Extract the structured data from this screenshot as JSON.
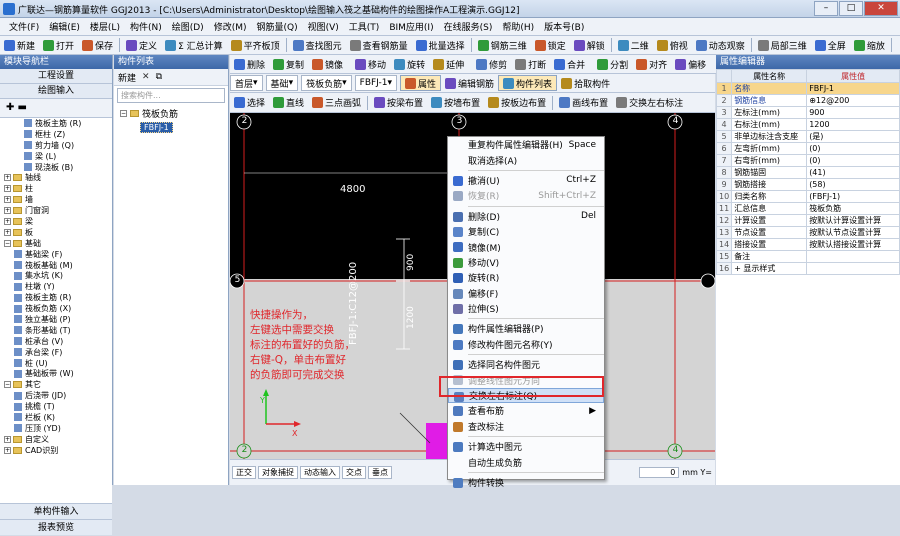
{
  "window": {
    "title": "广联达—钢筋算量软件 GGJ2013 - [C:\\Users\\Administrator\\Desktop\\绘图输入筏之基础构件的绘图操作A工程演示.GGJ12]"
  },
  "menu": [
    "文件(F)",
    "编辑(E)",
    "楼层(L)",
    "构件(N)",
    "绘图(D)",
    "修改(M)",
    "钢筋量(Q)",
    "视图(V)",
    "工具(T)",
    "BIM应用(I)",
    "在线服务(S)",
    "帮助(H)",
    "版本号(B)"
  ],
  "toolbar1": [
    "新建",
    "打开",
    "保存",
    "定义",
    "Σ 汇总计算",
    "平齐板顶",
    "查找图元",
    "查看钢筋量",
    "批量选择",
    "钢筋三维",
    "锁定",
    "解锁",
    "二维",
    "俯视",
    "动态观察",
    "局部三维",
    "全屏",
    "缩放"
  ],
  "toolbar2": [
    "删除",
    "复制",
    "镜像",
    "移动",
    "旋转",
    "延伸",
    "修剪",
    "打断",
    "合并",
    "分割",
    "对齐",
    "偏移",
    "拉伸",
    "设置夹点",
    "两点",
    "平行",
    "点角"
  ],
  "toolbar3": {
    "floor": "首层",
    "category": "基础",
    "type": "筏板负筋",
    "component": "FBFJ-1",
    "buttons": [
      "属性",
      "编辑钢筋",
      "构件列表",
      "拾取构件"
    ]
  },
  "toolbar4": [
    "选择",
    "直线",
    "三点画弧",
    "按梁布置",
    "按墙布置",
    "按板边布置",
    "画线布置",
    "交换左右标注"
  ],
  "left_nav": {
    "header": "模块导航栏",
    "buttons": [
      "工程设置",
      "绘图输入"
    ],
    "tree": [
      {
        "label": "筏板主筋 (R)",
        "level": 2,
        "kind": "item"
      },
      {
        "label": "框柱 (Z)",
        "level": 2,
        "kind": "item"
      },
      {
        "label": "剪力墙 (Q)",
        "level": 2,
        "kind": "item"
      },
      {
        "label": "梁 (L)",
        "level": 2,
        "kind": "item"
      },
      {
        "label": "现浇板 (B)",
        "level": 2,
        "kind": "item"
      },
      {
        "label": "轴线",
        "level": 0,
        "kind": "folder"
      },
      {
        "label": "柱",
        "level": 0,
        "kind": "folder"
      },
      {
        "label": "墙",
        "level": 0,
        "kind": "folder"
      },
      {
        "label": "门窗洞",
        "level": 0,
        "kind": "folder"
      },
      {
        "label": "梁",
        "level": 0,
        "kind": "folder"
      },
      {
        "label": "板",
        "level": 0,
        "kind": "folder"
      },
      {
        "label": "基础",
        "level": 0,
        "kind": "folder-open"
      },
      {
        "label": "基础梁 (F)",
        "level": 1,
        "kind": "item"
      },
      {
        "label": "筏板基础 (M)",
        "level": 1,
        "kind": "item"
      },
      {
        "label": "集水坑 (K)",
        "level": 1,
        "kind": "item"
      },
      {
        "label": "柱墩 (Y)",
        "level": 1,
        "kind": "item"
      },
      {
        "label": "筏板主筋 (R)",
        "level": 1,
        "kind": "item"
      },
      {
        "label": "筏板负筋 (X)",
        "level": 1,
        "kind": "item"
      },
      {
        "label": "独立基础 (P)",
        "level": 1,
        "kind": "item"
      },
      {
        "label": "条形基础 (T)",
        "level": 1,
        "kind": "item"
      },
      {
        "label": "桩承台 (V)",
        "level": 1,
        "kind": "item"
      },
      {
        "label": "承台梁 (F)",
        "level": 1,
        "kind": "item"
      },
      {
        "label": "桩 (U)",
        "level": 1,
        "kind": "item"
      },
      {
        "label": "基础板带 (W)",
        "level": 1,
        "kind": "item"
      },
      {
        "label": "其它",
        "level": 0,
        "kind": "folder-open"
      },
      {
        "label": "后浇带 (JD)",
        "level": 1,
        "kind": "item"
      },
      {
        "label": "挑檐 (T)",
        "level": 1,
        "kind": "item"
      },
      {
        "label": "栏板 (K)",
        "level": 1,
        "kind": "item"
      },
      {
        "label": "压顶 (YD)",
        "level": 1,
        "kind": "item"
      },
      {
        "label": "自定义",
        "level": 0,
        "kind": "folder"
      },
      {
        "label": "CAD识别",
        "level": 0,
        "kind": "folder"
      }
    ],
    "bottom_buttons": [
      "单构件输入",
      "报表预览"
    ]
  },
  "component_list": {
    "header": "构件列表",
    "toolbar": [
      "新建",
      "删除",
      "复制"
    ],
    "search_placeholder": "搜索构件...",
    "tree_root": "筏板负筋",
    "tree_item": "FBFJ-1"
  },
  "canvas": {
    "axes_top": [
      "2",
      "3",
      "4"
    ],
    "axes_bottom": [
      "2",
      "3",
      "4"
    ],
    "axis_side": "5",
    "dimension": "4800",
    "rebar_label": "FBFJ-1:C12@200",
    "dim_900": "900",
    "dim_1200": "1200",
    "hint_lines": [
      "快捷操作为，",
      "左键选中需要交换",
      "标注的布置好的负筋，",
      "右键-Q，单击布置好",
      "的负筋即可完成交换"
    ]
  },
  "context_menu": {
    "items": [
      {
        "label": "重复构件属性编辑器(H)",
        "shortcut": "Space",
        "icon": false,
        "disabled": false
      },
      {
        "label": "取消选择(A)",
        "shortcut": "",
        "icon": false,
        "disabled": false
      },
      {
        "sep": true
      },
      {
        "label": "撤消(U)",
        "shortcut": "Ctrl+Z",
        "icon": true,
        "disabled": false,
        "color": "#3a6bd1"
      },
      {
        "label": "恢复(R)",
        "shortcut": "Shift+Ctrl+Z",
        "icon": true,
        "disabled": true,
        "color": "#9aa9c4"
      },
      {
        "sep": true
      },
      {
        "label": "删除(D)",
        "shortcut": "Del",
        "icon": true,
        "disabled": false,
        "color": "#4a6fb0"
      },
      {
        "label": "复制(C)",
        "shortcut": "",
        "icon": true,
        "disabled": false,
        "color": "#5a84c9"
      },
      {
        "label": "镜像(M)",
        "shortcut": "",
        "icon": true,
        "disabled": false,
        "color": "#3d6cc0"
      },
      {
        "label": "移动(V)",
        "shortcut": "",
        "icon": true,
        "disabled": false,
        "color": "#3c9b3c"
      },
      {
        "label": "旋转(R)",
        "shortcut": "",
        "icon": true,
        "disabled": false,
        "color": "#2f5fb5"
      },
      {
        "label": "偏移(F)",
        "shortcut": "",
        "icon": true,
        "disabled": false,
        "color": "#6688bb"
      },
      {
        "label": "拉伸(S)",
        "shortcut": "",
        "icon": true,
        "disabled": false,
        "color": "#6f6fa8"
      },
      {
        "sep": true
      },
      {
        "label": "构件属性编辑器(P)",
        "shortcut": "",
        "icon": true,
        "disabled": false,
        "color": "#4477bb"
      },
      {
        "label": "修改构件图元名称(Y)",
        "shortcut": "",
        "icon": true,
        "disabled": false,
        "color": "#4d7ac2"
      },
      {
        "sep": true
      },
      {
        "label": "选择同名构件图元",
        "shortcut": "",
        "icon": true,
        "disabled": false,
        "color": "#3f70b8"
      },
      {
        "label": "调整线性图元方向",
        "shortcut": "",
        "icon": true,
        "disabled": true,
        "color": "#b5bfd0"
      },
      {
        "label": "交换左右标注(Q)",
        "shortcut": "",
        "icon": true,
        "disabled": false,
        "color": "#5a7fbf",
        "highlight": true
      },
      {
        "label": "查看布筋",
        "shortcut": "▶",
        "icon": true,
        "disabled": false,
        "color": "#4e79be"
      },
      {
        "label": "查改标注",
        "shortcut": "",
        "icon": true,
        "disabled": false,
        "color": "#c0792b"
      },
      {
        "sep": true
      },
      {
        "label": "计算选中图元",
        "shortcut": "",
        "icon": true,
        "disabled": false,
        "color": "#4c7abf"
      },
      {
        "label": "自动生成负筋",
        "shortcut": "",
        "icon": false,
        "disabled": false
      },
      {
        "sep": true
      },
      {
        "label": "构件转换",
        "shortcut": "",
        "icon": true,
        "disabled": false,
        "color": "#4f7cc0"
      }
    ]
  },
  "properties": {
    "header": "属性编辑器",
    "col_name": "属性名称",
    "col_value": "属性值",
    "rows": [
      {
        "n": "1",
        "k": "名称",
        "v": "FBFJ-1",
        "blue": true
      },
      {
        "n": "2",
        "k": "钢筋信息",
        "v": "⊕12@200",
        "blue": true
      },
      {
        "n": "3",
        "k": "左标注(mm)",
        "v": "900",
        "blue": false
      },
      {
        "n": "4",
        "k": "右标注(mm)",
        "v": "1200",
        "blue": false
      },
      {
        "n": "5",
        "k": "非单边标注含支座",
        "v": "(是)",
        "blue": false
      },
      {
        "n": "6",
        "k": "左弯折(mm)",
        "v": "(0)",
        "blue": false
      },
      {
        "n": "7",
        "k": "右弯折(mm)",
        "v": "(0)",
        "blue": false
      },
      {
        "n": "8",
        "k": "钢筋锚固",
        "v": "(41)",
        "blue": false
      },
      {
        "n": "9",
        "k": "钢筋搭接",
        "v": "(58)",
        "blue": false
      },
      {
        "n": "10",
        "k": "归类名称",
        "v": "(FBFJ-1)",
        "blue": false
      },
      {
        "n": "11",
        "k": "汇总信息",
        "v": "筏板负筋",
        "blue": false
      },
      {
        "n": "12",
        "k": "计算设置",
        "v": "按默认计算设置计算",
        "blue": false
      },
      {
        "n": "13",
        "k": "节点设置",
        "v": "按默认节点设置计算",
        "blue": false
      },
      {
        "n": "14",
        "k": "搭接设置",
        "v": "按默认搭接设置计算",
        "blue": false
      },
      {
        "n": "15",
        "k": "备注",
        "v": "",
        "blue": false
      },
      {
        "n": "16",
        "k": "+ 显示样式",
        "v": "",
        "blue": false
      }
    ]
  },
  "statusbar": {
    "items": [
      "正交",
      "对象捕捉",
      "动态输入",
      "交点",
      "垂点"
    ],
    "coord_value": "0",
    "coord_unit": "mm Y="
  },
  "colors": {
    "accent": "#3d68a8",
    "highlight_box": "#e0262b",
    "hint_text": "#e0262b",
    "canvas_grid": "#d41e1e"
  }
}
